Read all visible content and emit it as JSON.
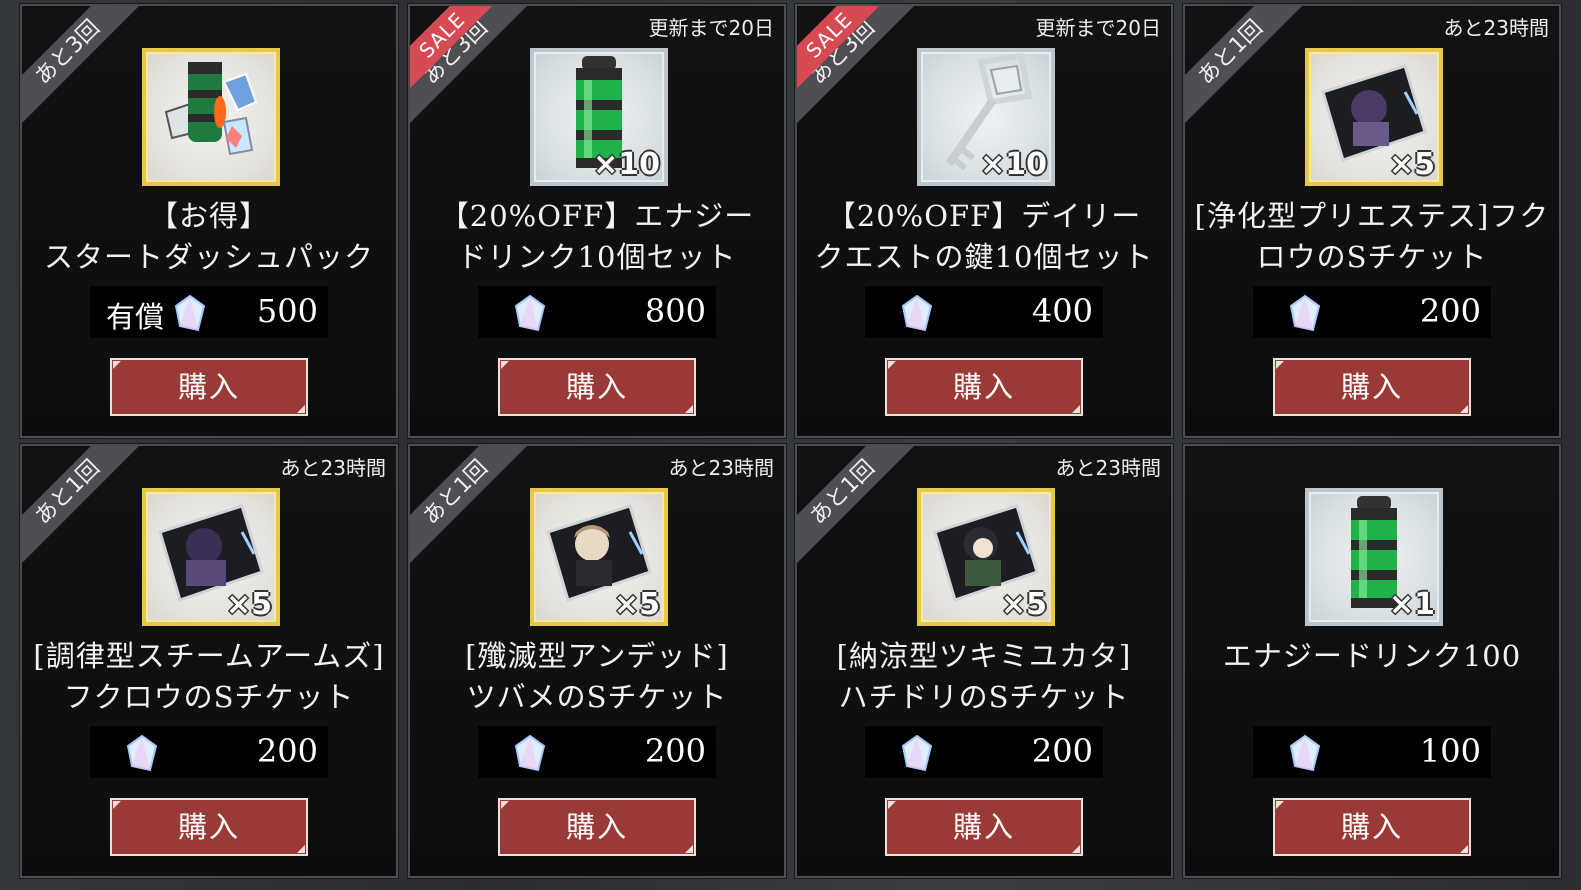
{
  "items": [
    {
      "limit": "あと3回",
      "sale": "",
      "timer": "",
      "name1": "【お得】",
      "name2": "スタートダッシュパック",
      "paid_label": "有償",
      "price": "500",
      "qty": "",
      "frame": "gold",
      "icon": "pack-icon",
      "buy": "購入"
    },
    {
      "limit": "あと3回",
      "sale": "SALE",
      "timer": "更新まで20日",
      "name1": "【20%OFF】エナジー",
      "name2": "ドリンク10個セット",
      "paid_label": "",
      "price": "800",
      "qty": "×10",
      "frame": "silver",
      "icon": "energy-drink-icon",
      "buy": "購入"
    },
    {
      "limit": "あと3回",
      "sale": "SALE",
      "timer": "更新まで20日",
      "name1": "【20%OFF】デイリー",
      "name2": "クエストの鍵10個セット",
      "paid_label": "",
      "price": "400",
      "qty": "×10",
      "frame": "silver",
      "icon": "key-icon",
      "buy": "購入"
    },
    {
      "limit": "あと1回",
      "sale": "",
      "timer": "あと23時間",
      "name1": "[浄化型プリエステス]フク",
      "name2": "ロウのSチケット",
      "paid_label": "",
      "price": "200",
      "qty": "×5",
      "frame": "gold",
      "icon": "ticket-icon",
      "buy": "購入"
    },
    {
      "limit": "あと1回",
      "sale": "",
      "timer": "あと23時間",
      "name1": "[調律型スチームアームズ]",
      "name2": "フクロウのSチケット",
      "paid_label": "",
      "price": "200",
      "qty": "×5",
      "frame": "gold",
      "icon": "ticket-icon",
      "buy": "購入"
    },
    {
      "limit": "あと1回",
      "sale": "",
      "timer": "あと23時間",
      "name1": "[殲滅型アンデッド]",
      "name2": "ツバメのSチケット",
      "paid_label": "",
      "price": "200",
      "qty": "×5",
      "frame": "gold",
      "icon": "ticket-icon",
      "buy": "購入"
    },
    {
      "limit": "あと1回",
      "sale": "",
      "timer": "あと23時間",
      "name1": "[納涼型ツキミユカタ]",
      "name2": "ハチドリのSチケット",
      "paid_label": "",
      "price": "200",
      "qty": "×5",
      "frame": "gold",
      "icon": "ticket-icon",
      "buy": "購入"
    },
    {
      "limit": "",
      "sale": "",
      "timer": "",
      "name1": "エナジードリンク100",
      "name2": "",
      "paid_label": "",
      "price": "100",
      "qty": "×1",
      "frame": "silver",
      "icon": "energy-drink-icon",
      "buy": "購入"
    }
  ]
}
